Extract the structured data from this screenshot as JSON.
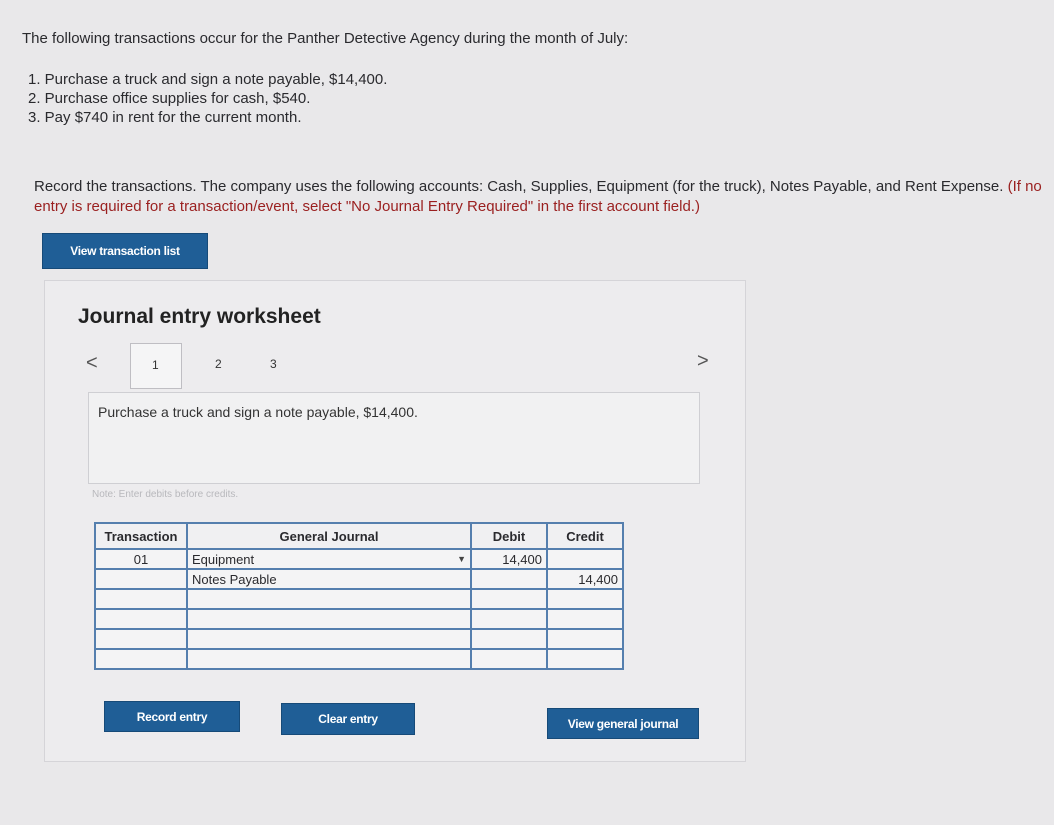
{
  "intro": "The following transactions occur for the Panther Detective Agency during the month of July:",
  "transactions": [
    "1. Purchase a truck and sign a note payable, $14,400.",
    "2. Purchase office supplies for cash, $540.",
    "3. Pay $740 in rent for the current month."
  ],
  "instructions": "Record the transactions. The company uses the following accounts: Cash, Supplies, Equipment (for the truck), Notes Payable, and Rent Expense.",
  "instructions_note": "(If no entry is required for a transaction/event, select \"No Journal Entry Required\" in the first account field.)",
  "view_list_button": "View transaction list",
  "worksheet": {
    "title": "Journal entry worksheet",
    "prev_arrow": "<",
    "next_arrow": ">",
    "tabs": [
      "1",
      "2",
      "3"
    ],
    "description": "Purchase a truck and sign a note payable, $14,400.",
    "note": "Note: Enter debits before credits.",
    "headers": {
      "transaction": "Transaction",
      "journal": "General Journal",
      "debit": "Debit",
      "credit": "Credit"
    },
    "rows": [
      {
        "transaction": "01",
        "account": "Equipment",
        "debit": "14,400",
        "credit": ""
      },
      {
        "transaction": "",
        "account": "Notes Payable",
        "debit": "",
        "credit": "14,400"
      },
      {
        "transaction": "",
        "account": "",
        "debit": "",
        "credit": ""
      },
      {
        "transaction": "",
        "account": "",
        "debit": "",
        "credit": ""
      },
      {
        "transaction": "",
        "account": "",
        "debit": "",
        "credit": ""
      },
      {
        "transaction": "",
        "account": "",
        "debit": "",
        "credit": ""
      }
    ],
    "record_button": "Record entry",
    "clear_button": "Clear entry",
    "view_journal_button": "View general journal"
  }
}
